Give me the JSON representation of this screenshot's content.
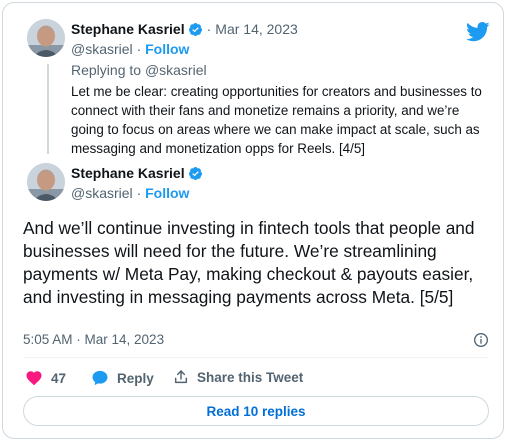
{
  "tweet1": {
    "author_name": "Stephane Kasriel",
    "date": "Mar 14, 2023",
    "handle": "@skasriel",
    "follow_label": "Follow",
    "replying_prefix": "Replying to",
    "replying_to": "@skasriel",
    "text": "Let me be clear: creating opportunities for creators and businesses to connect with their fans and monetize remains a priority, and we’re going to focus on areas where we can make impact at scale, such as messaging and monetization opps for Reels. [4/5]"
  },
  "tweet2": {
    "author_name": "Stephane Kasriel",
    "handle": "@skasriel",
    "follow_label": "Follow",
    "text": "And we’ll continue investing in fintech tools that people and businesses will need for the future. We’re streamlining payments w/ Meta Pay, making checkout & payouts easier, and investing in messaging payments across Meta. [5/5]",
    "timestamp": "5:05 AM · Mar 14, 2023"
  },
  "actions": {
    "like_count": "47",
    "reply_label": "Reply",
    "share_label": "Share this Tweet"
  },
  "read_replies_label": "Read 10 replies",
  "icons": {
    "brand": "twitter-bird-icon",
    "verified": "verified-badge-icon",
    "like": "heart-icon",
    "reply": "speech-bubble-icon",
    "share": "share-upload-icon",
    "info": "info-icon"
  },
  "colors": {
    "brand_blue": "#1d9bf0",
    "like_red": "#f91880",
    "text_primary": "#0f1419",
    "text_secondary": "#536471",
    "border": "#cfd9de"
  }
}
